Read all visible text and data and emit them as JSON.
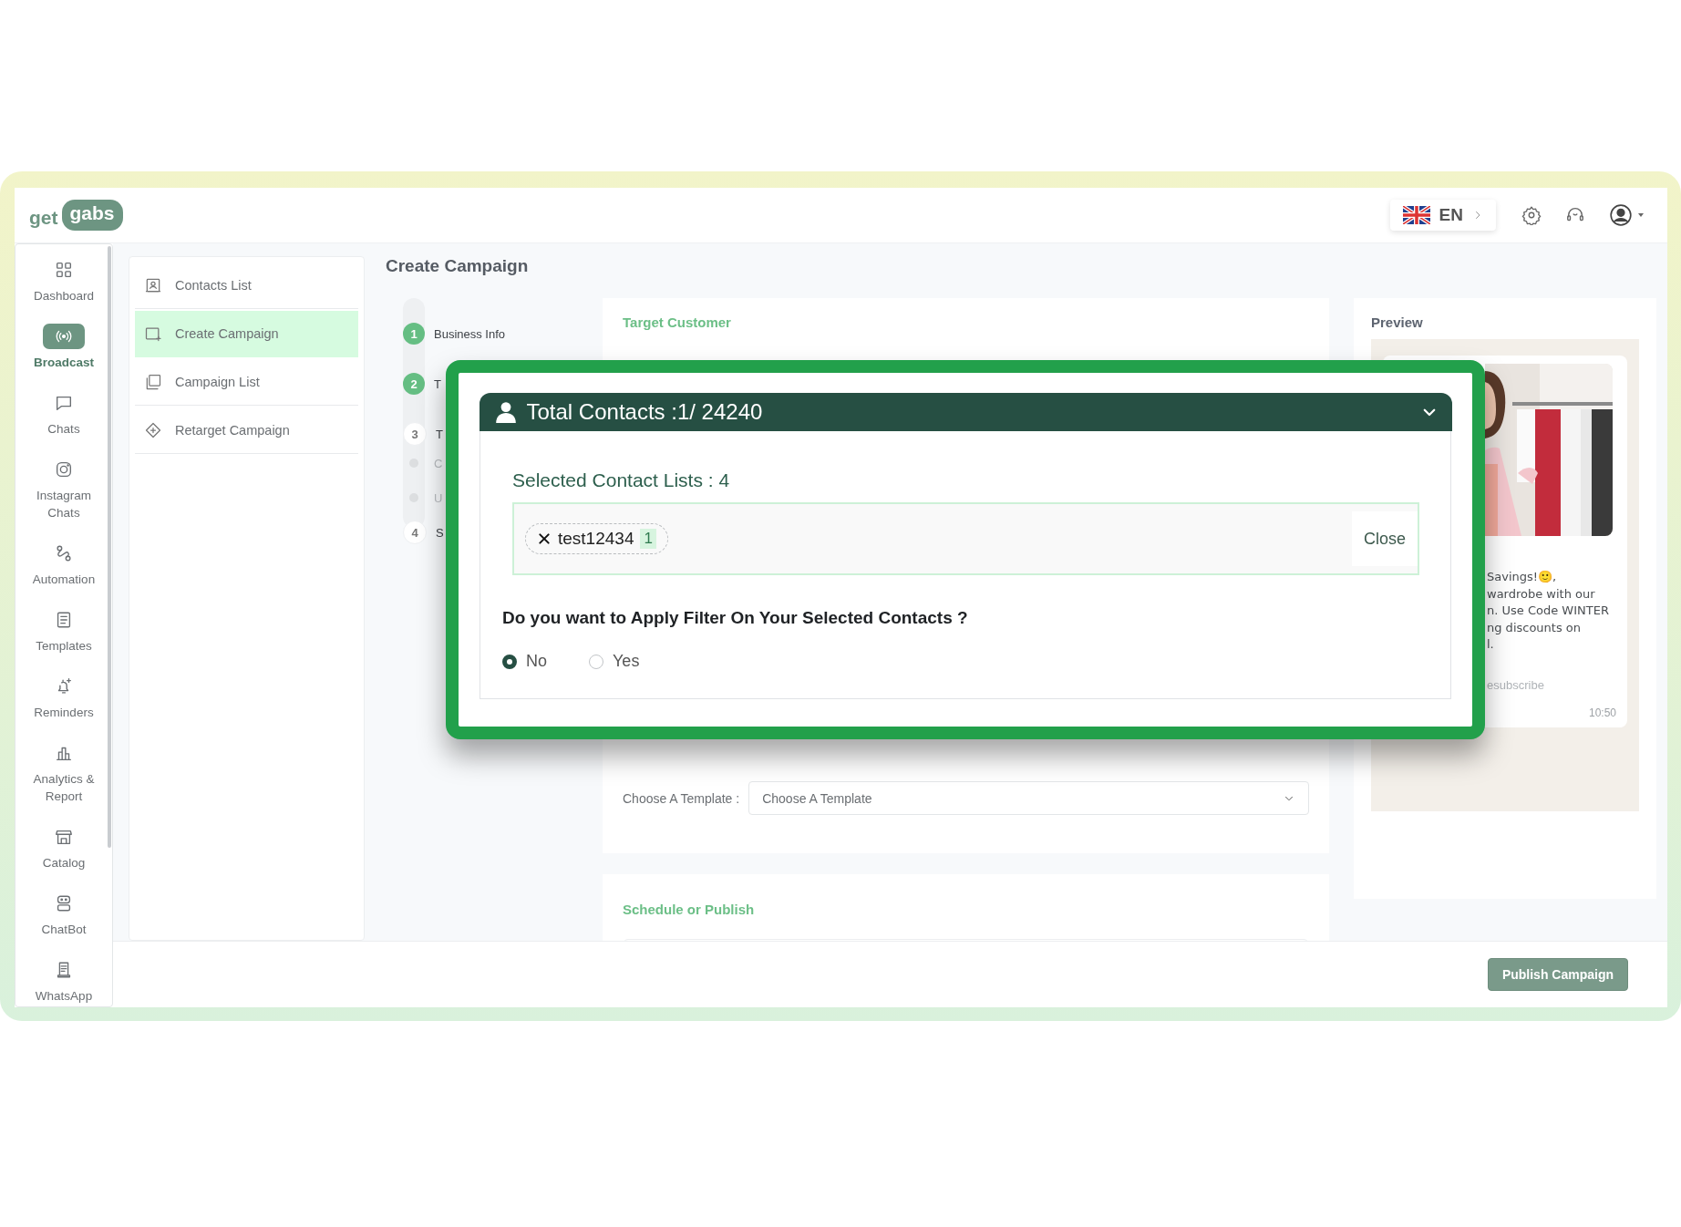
{
  "header": {
    "logo": {
      "word_1": "get",
      "word_2": "gabs"
    },
    "language": "EN"
  },
  "sidebar": {
    "items": [
      {
        "label": "Dashboard",
        "selected": false
      },
      {
        "label": "Broadcast",
        "selected": true
      },
      {
        "label": "Chats",
        "selected": false
      },
      {
        "label": "Instagram Chats",
        "selected": false
      },
      {
        "label": "Automation",
        "selected": false
      },
      {
        "label": "Templates",
        "selected": false
      },
      {
        "label": "Reminders",
        "selected": false
      },
      {
        "label": "Analytics & Report",
        "selected": false
      },
      {
        "label": "Catalog",
        "selected": false
      },
      {
        "label": "ChatBot",
        "selected": false
      },
      {
        "label": "WhatsApp",
        "selected": false
      }
    ]
  },
  "submenu": {
    "items": [
      {
        "label": "Contacts List",
        "selected": false
      },
      {
        "label": "Create Campaign",
        "selected": true
      },
      {
        "label": "Campaign List",
        "selected": false
      },
      {
        "label": "Retarget Campaign",
        "selected": false
      }
    ]
  },
  "page_title": "Create Campaign",
  "steps": [
    {
      "kind": "step",
      "number": "1",
      "label": "Business Info",
      "completed": true
    },
    {
      "kind": "step",
      "number": "2",
      "label": "T",
      "completed": true
    },
    {
      "kind": "step",
      "number": "3",
      "label": "T",
      "completed": false
    },
    {
      "kind": "substep",
      "label": "C"
    },
    {
      "kind": "substep",
      "label": "U"
    },
    {
      "kind": "step",
      "number": "4",
      "label": "S",
      "completed": false
    }
  ],
  "target_customer": {
    "title": "Target Customer",
    "template_label": "Choose A Template :",
    "template_select": {
      "placeholder": "Choose A Template"
    }
  },
  "schedule": {
    "title": "Schedule or Publish"
  },
  "preview": {
    "title": "Preview",
    "message_lines": [
      "Savings!🙂,",
      "wardrobe with our",
      "n. Use Code WINTER",
      "ng discounts on",
      "l."
    ],
    "footer_text": "esubscribe",
    "time": "10:50"
  },
  "footer": {
    "publish_button": "Publish Campaign"
  },
  "callout": {
    "title": "Total Contacts :1/ 24240",
    "selected_lists_label": "Selected Contact Lists : 4",
    "chips": [
      {
        "name": "test12434",
        "count": "1"
      }
    ],
    "close_button": "Close",
    "question": "Do you want to Apply Filter On Your Selected Contacts ?",
    "options": [
      {
        "label": "No",
        "selected": true
      },
      {
        "label": "Yes",
        "selected": false
      }
    ]
  }
}
